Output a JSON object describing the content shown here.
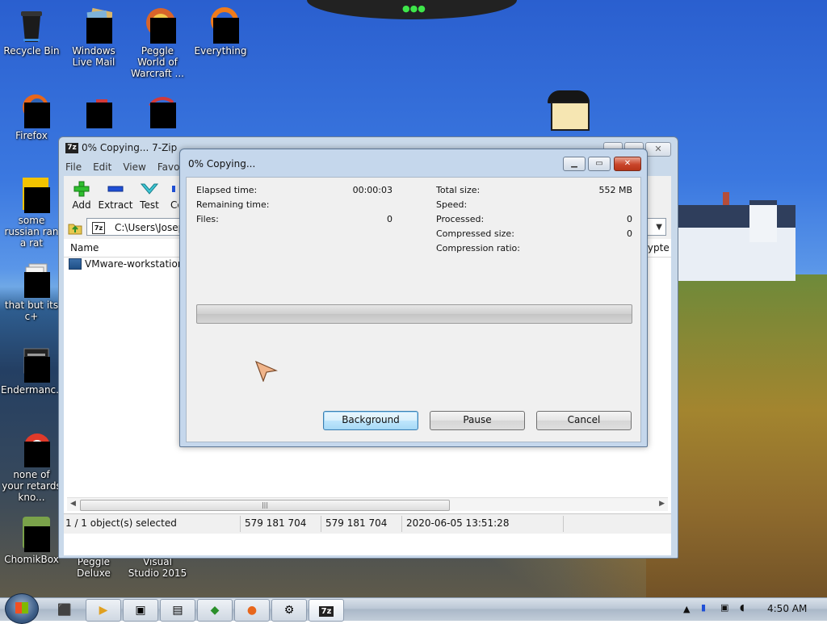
{
  "desktop": {
    "icons": [
      {
        "label": "Recycle Bin"
      },
      {
        "label": "Windows Live Mail"
      },
      {
        "label": "Peggle World of Warcraft ..."
      },
      {
        "label": "Everything"
      },
      {
        "label": "Firefox"
      },
      {
        "label": "some russian ran a rat"
      },
      {
        "label": "that but its c+"
      },
      {
        "label": "Endermanc..."
      },
      {
        "label": "none of your retards kno..."
      },
      {
        "label": "ChomikBox"
      },
      {
        "label": "Peggle Deluxe"
      },
      {
        "label": "Visual Studio 2015"
      }
    ]
  },
  "main_window": {
    "app_icon": "7z",
    "title": "0% Copying... 7-Zip",
    "menu": [
      "File",
      "Edit",
      "View",
      "Favor"
    ],
    "toolbar": {
      "add": "Add",
      "extract": "Extract",
      "test": "Test",
      "copy": "Co"
    },
    "address": "C:\\Users\\Joseph",
    "columns": {
      "name": "Name",
      "encrypted": "rypte"
    },
    "files": [
      {
        "name": "VMware-workstation-f"
      }
    ],
    "status": {
      "selected": "1 / 1 object(s) selected",
      "size": "579 181 704",
      "packed": "579 181 704",
      "modified": "2020-06-05 13:51:28"
    }
  },
  "dialog": {
    "title": "0% Copying...",
    "left_stats": {
      "elapsed_label": "Elapsed time:",
      "elapsed_value": "00:00:03",
      "remaining_label": "Remaining time:",
      "remaining_value": "",
      "files_label": "Files:",
      "files_value": "0"
    },
    "right_stats": {
      "total_label": "Total size:",
      "total_value": "552 MB",
      "speed_label": "Speed:",
      "speed_value": "",
      "processed_label": "Processed:",
      "processed_value": "0",
      "compressed_label": "Compressed size:",
      "compressed_value": "0",
      "ratio_label": "Compression ratio:",
      "ratio_value": ""
    },
    "progress_fraction": 0,
    "buttons": {
      "background": "Background",
      "pause": "Pause",
      "cancel": "Cancel"
    }
  },
  "taskbar": {
    "clock": "4:50 AM"
  }
}
